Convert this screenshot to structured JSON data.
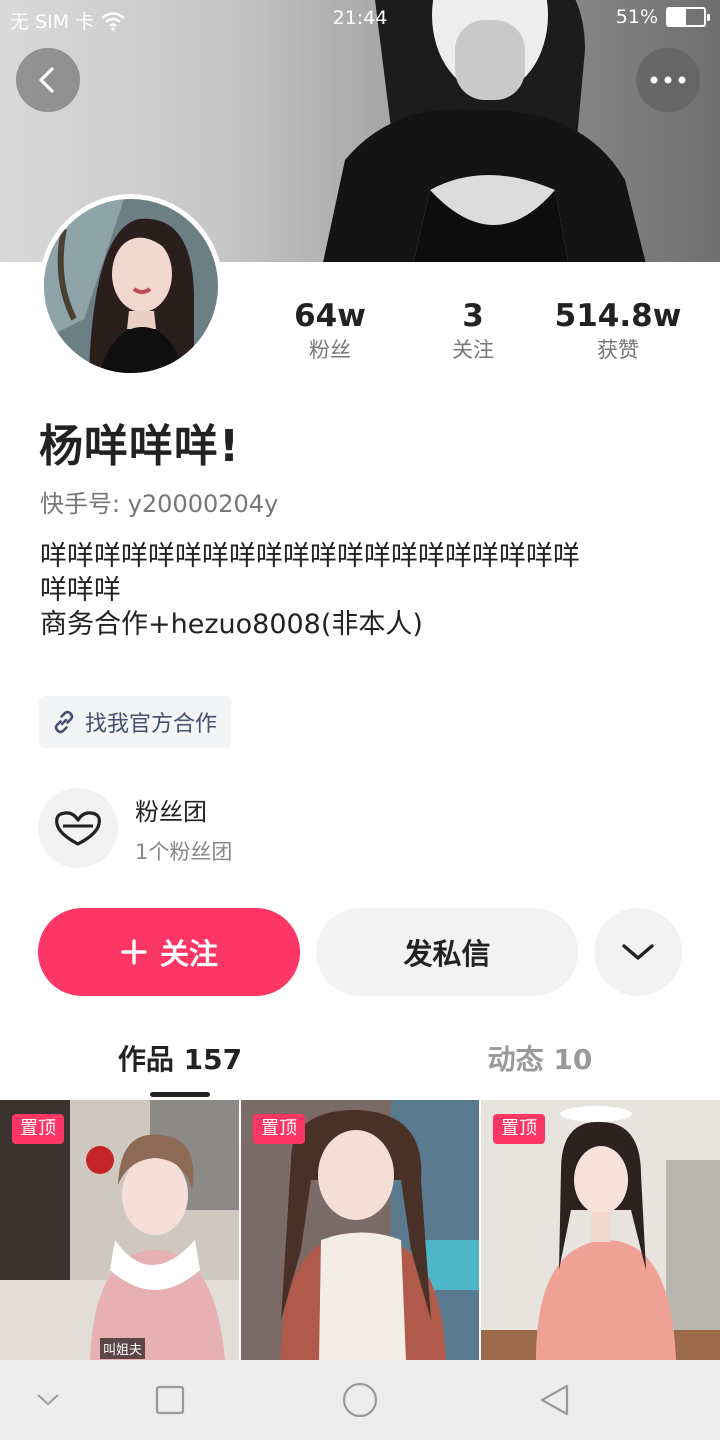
{
  "status_bar": {
    "carrier": "无 SIM 卡",
    "time": "21:44",
    "battery": "51%",
    "battery_level": 0.51
  },
  "header": {
    "back_icon": "chevron-left-icon",
    "more_icon": "more-dots-icon"
  },
  "profile": {
    "stats": [
      {
        "value": "64w",
        "label": "粉丝"
      },
      {
        "value": "3",
        "label": "关注"
      },
      {
        "value": "514.8w",
        "label": "获赞"
      }
    ],
    "name": "杨咩咩咩!",
    "handle": "快手号: y20000204y",
    "bio_lines": [
      "咩咩咩咩咩咩咩咩咩咩咩咩咩咩咩咩咩咩咩咩",
      "咩咩咩",
      "商务合作+hezuo8008(非本人)"
    ],
    "cooperation_label": "找我官方合作"
  },
  "fan_club": {
    "title": "粉丝团",
    "subtitle": "1个粉丝团"
  },
  "actions": {
    "follow_label": "关注",
    "message_label": "发私信"
  },
  "tabs": [
    {
      "label": "作品 157",
      "active": true
    },
    {
      "label": "动态 10",
      "active": false
    }
  ],
  "videos": [
    {
      "pinned_label": "置顶",
      "caption": "叫姐夫"
    },
    {
      "pinned_label": "置顶",
      "caption": ""
    },
    {
      "pinned_label": "置顶",
      "caption": ""
    }
  ],
  "colors": {
    "accent": "#fe3666",
    "muted_text": "#777777",
    "link_text": "#44506e"
  }
}
